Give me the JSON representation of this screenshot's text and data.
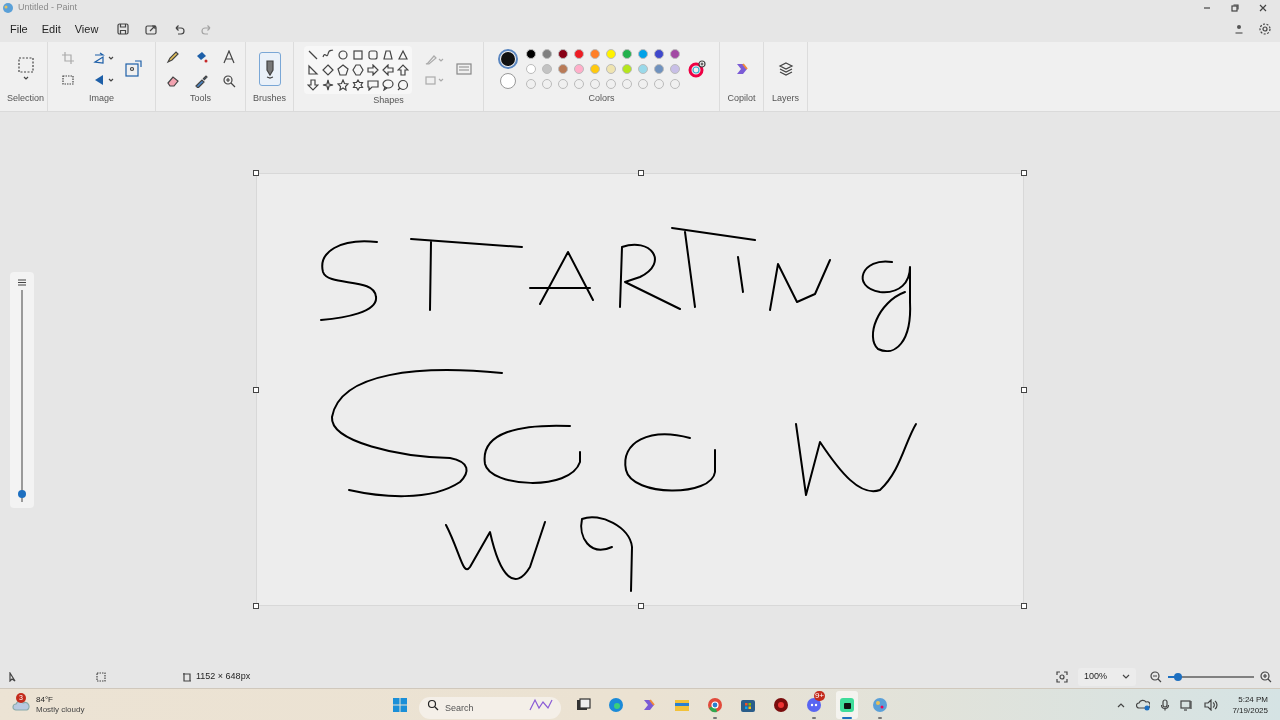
{
  "window": {
    "title": "Untitled - Paint"
  },
  "menu": [
    "File",
    "Edit",
    "View"
  ],
  "ribbon_groups": [
    {
      "kind": "selection",
      "label": "Selection"
    },
    {
      "kind": "image",
      "label": "Image"
    },
    {
      "kind": "tools",
      "label": "Tools"
    },
    {
      "kind": "brushes",
      "label": "Brushes"
    },
    {
      "kind": "shapes",
      "label": "Shapes"
    },
    {
      "kind": "colors",
      "label": "Colors"
    },
    {
      "kind": "copilot",
      "label": "Copilot"
    },
    {
      "kind": "layers",
      "label": "Layers"
    }
  ],
  "colors": {
    "primary": {
      "color": "#111111"
    },
    "secondary": {
      "color": "#ffffff"
    },
    "palette": [
      {
        "color": "#000000"
      },
      {
        "color": "#7f7f7f"
      },
      {
        "color": "#880015"
      },
      {
        "color": "#ed1c24"
      },
      {
        "color": "#ff7f27"
      },
      {
        "color": "#fff200"
      },
      {
        "color": "#22b14c"
      },
      {
        "color": "#00a2e8"
      },
      {
        "color": "#3f48cc"
      },
      {
        "color": "#a349a4"
      },
      {
        "color": "#ffffff"
      },
      {
        "color": "#c3c3c3"
      },
      {
        "color": "#b97a57"
      },
      {
        "color": "#ffaec9"
      },
      {
        "color": "#ffc90e"
      },
      {
        "color": "#efe4b0"
      },
      {
        "color": "#b5e61d"
      },
      {
        "color": "#99d9ea"
      },
      {
        "color": "#7092be"
      },
      {
        "color": "#c8bfe7"
      }
    ]
  },
  "brush_size": {
    "level": 0.04
  },
  "status_bar": {
    "canvas_size": "1152 × 648px",
    "zoom": "100%",
    "zoom_slider": {
      "level": 0.12
    }
  },
  "taskbar": {
    "weather": {
      "temperature": "84°F",
      "condition": "Mostly cloudy",
      "badge": "3"
    },
    "search_placeholder": "Search",
    "apps": [
      {
        "kind": "taskview",
        "running": false,
        "selected": false
      },
      {
        "kind": "edge",
        "running": false,
        "selected": false
      },
      {
        "kind": "copilot",
        "running": false,
        "selected": false
      },
      {
        "kind": "explorer",
        "running": false,
        "selected": false
      },
      {
        "kind": "chrome",
        "running": true,
        "selected": false
      },
      {
        "kind": "store",
        "running": false,
        "selected": false
      },
      {
        "kind": "red",
        "running": false,
        "selected": false
      },
      {
        "kind": "discord",
        "running": true,
        "selected": false,
        "badge": "9+"
      },
      {
        "kind": "green",
        "running": true,
        "selected": true
      },
      {
        "kind": "paint",
        "running": true,
        "selected": false
      }
    ],
    "time": "5:24 PM",
    "date": "7/19/2025"
  }
}
